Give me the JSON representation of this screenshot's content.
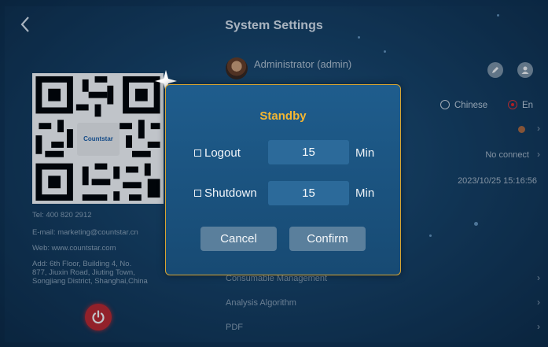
{
  "header": {
    "title": "System Settings",
    "back_icon": "chevron-left-icon"
  },
  "user": {
    "name": "Administrator (admin)"
  },
  "contact": {
    "qr_logo": "Countstar",
    "tel": "Tel: 400 820 2912",
    "email": "E-mail: marketing@countstar.cn",
    "web": "Web: www.countstar.com",
    "address_line1": "Add: 6th Floor, Building 4, No.",
    "address_line2": "877, Jiuxin Road, Jiuting Town,",
    "address_line3": "Songjiang District, Shanghai,China"
  },
  "language": {
    "option1": "Chinese",
    "option2": "En",
    "selected": "En"
  },
  "status": {
    "connection": "No connect",
    "datetime": "2023/10/25 15:16:56"
  },
  "menu": {
    "item1": "Consumable Management",
    "item2": "Analysis Algorithm",
    "item3": "PDF"
  },
  "dialog": {
    "title": "Standby",
    "logout_label": "Logout",
    "logout_value": "15",
    "shutdown_label": "Shutdown",
    "shutdown_value": "15",
    "unit": "Min",
    "cancel_label": "Cancel",
    "confirm_label": "Confirm"
  },
  "colors": {
    "accent": "#f5b731",
    "power": "#c2262b",
    "dialog_bg": "#1f5d8d"
  }
}
